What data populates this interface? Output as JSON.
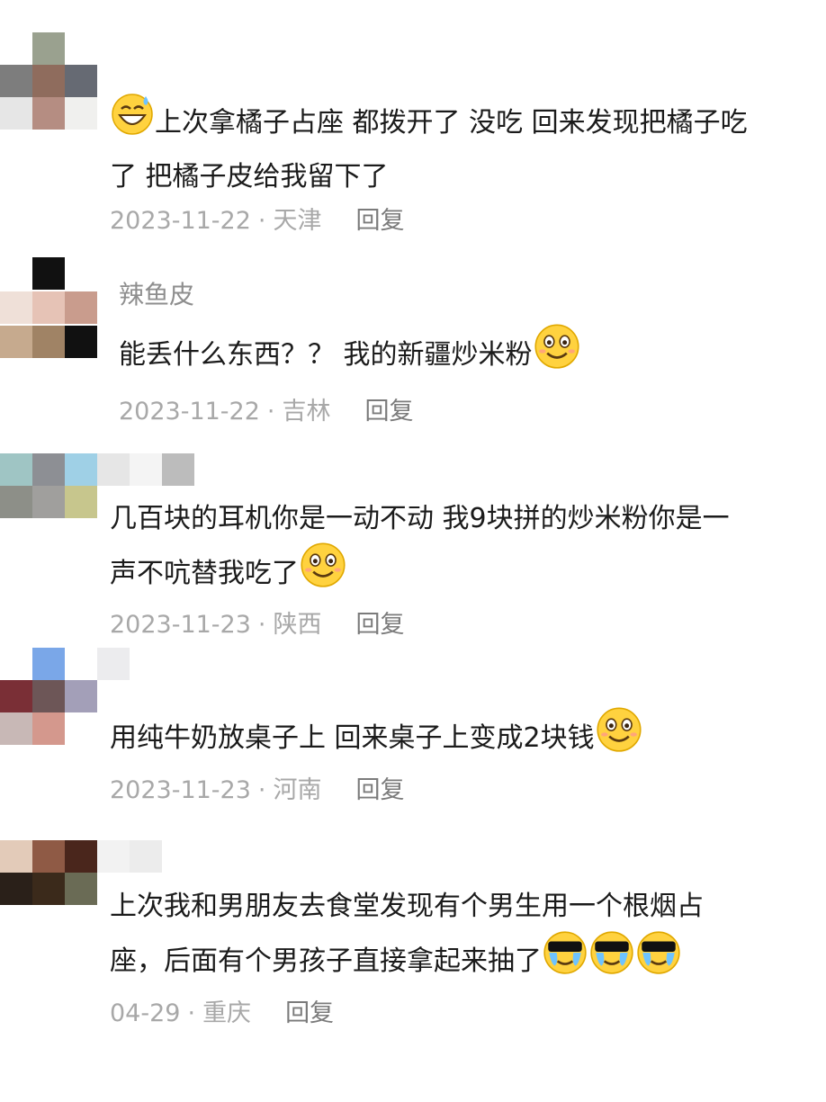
{
  "comments": [
    {
      "lines": [
        "上次拿橘子占座 都拨开了 没吃 回来发现把橘子吃",
        "了 把橘子皮给我留下了"
      ],
      "date": "2023-11-22",
      "sep": "·",
      "location": "天津",
      "reply": "回复",
      "emoji": "laugh-sweat-emoji"
    },
    {
      "username": "辣鱼皮",
      "lines": [
        "能丢什么东西？？ 我的新疆炒米粉"
      ],
      "date": "2023-11-22",
      "sep": "·",
      "location": "吉林",
      "reply": "回复",
      "emoji": "smile-emoji"
    },
    {
      "lines": [
        "几百块的耳机你是一动不动 我9块拼的炒米粉你是一",
        "声不吭替我吃了"
      ],
      "date": "2023-11-23",
      "sep": "·",
      "location": "陕西",
      "reply": "回复",
      "emoji": "smile-emoji"
    },
    {
      "lines": [
        "用纯牛奶放桌子上 回来桌子上变成2块钱"
      ],
      "date": "2023-11-23",
      "sep": "·",
      "location": "河南",
      "reply": "回复",
      "emoji": "smile-emoji"
    },
    {
      "lines": [
        "上次我和男朋友去食堂发现有个男生用一个根烟占",
        "座，后面有个男孩子直接拿起来抽了"
      ],
      "date": "04-29",
      "sep": "·",
      "location": "重庆",
      "reply": "回复",
      "emoji": "cool-tears-emoji"
    }
  ],
  "colors": {
    "text": "#1b1b1b",
    "meta": "#a8a8a8",
    "reply": "#7b7b7b",
    "username": "#8e8e8e",
    "emoji_face": "#ffd23f"
  }
}
